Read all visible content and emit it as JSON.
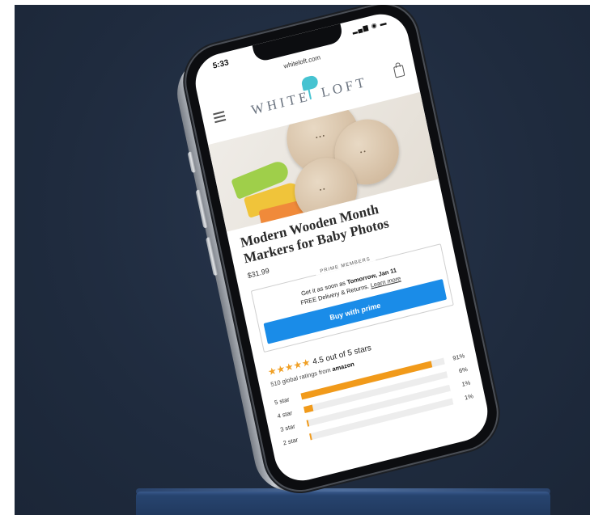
{
  "colors": {
    "accent": "#1a8ce8",
    "star": "#f0a026",
    "bar": "#f19a1a",
    "background": "#1f2b3e"
  },
  "status": {
    "time": "5:33",
    "icons": "signal-wifi-battery"
  },
  "browser": {
    "url": "whiteloft.com"
  },
  "header": {
    "logo_left": "WHITE",
    "logo_right": "LOFT",
    "menu_icon": "hamburger-menu-icon",
    "cart_icon": "shopping-bag-icon"
  },
  "product": {
    "title": "Modern Wooden Month Markers for Baby Photos",
    "price": "$31.99"
  },
  "prime": {
    "label": "PRIME MEMBERS",
    "delivery_prefix": "Get it as soon as",
    "delivery_date": "Tomorrow, Jan 11",
    "returns_text": "FREE Delivery & Returns.",
    "returns_link": "Learn more",
    "button_label": "Buy with prime"
  },
  "ratings": {
    "stars_display": "★★★★★",
    "stars_value": 4.5,
    "summary": "4.5 out of 5 stars",
    "global_prefix": "510 global ratings from",
    "global_source": "amazon",
    "histogram": [
      {
        "label": "5 star",
        "percent_text": "91%",
        "value": 91
      },
      {
        "label": "4 star",
        "percent_text": "6%",
        "value": 6
      },
      {
        "label": "3 star",
        "percent_text": "1%",
        "value": 1
      },
      {
        "label": "2 star",
        "percent_text": "1%",
        "value": 1
      }
    ]
  }
}
